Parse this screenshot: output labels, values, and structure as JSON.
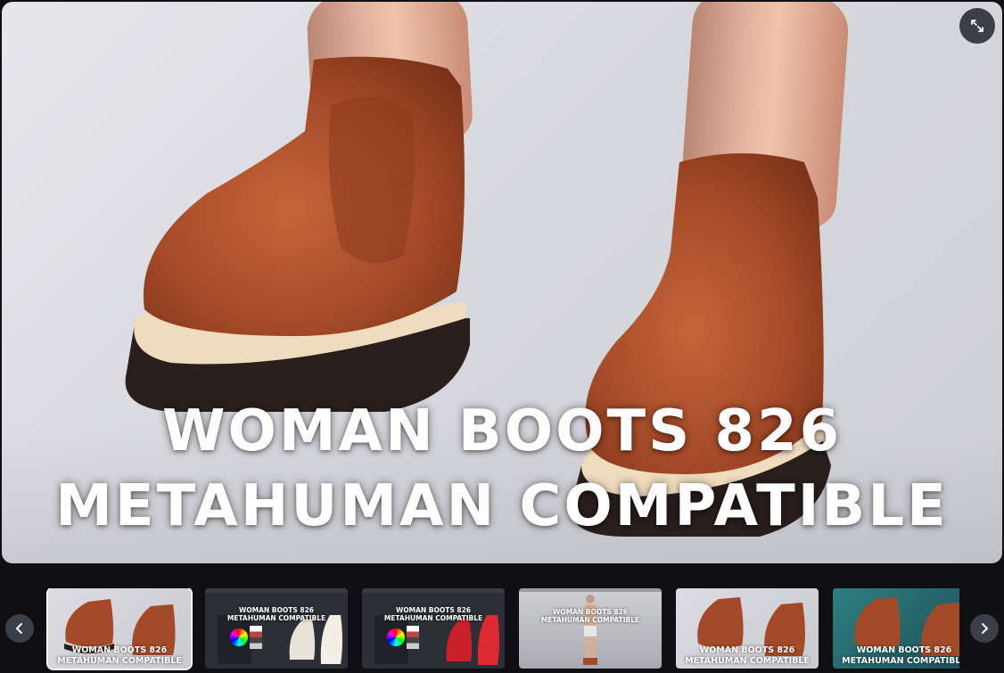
{
  "main": {
    "title_line1": "WOMAN BOOTS 826",
    "title_line2": "METAHUMAN COMPATIBLE",
    "expand_icon": "expand-icon",
    "colors": {
      "boot": "#b2532e",
      "sole": "#2a1f1c",
      "welt": "#efdcbf"
    }
  },
  "gallery": {
    "prev_icon": "chevron-left-icon",
    "next_icon": "chevron-right-icon",
    "thumbnails": [
      {
        "caption_line1": "WOMAN BOOTS 826",
        "caption_line2": "METAHUMAN COMPATIBLE",
        "active": true
      },
      {
        "caption_line1": "WOMAN BOOTS 826",
        "caption_line2": "METAHUMAN COMPATIBLE",
        "active": false
      },
      {
        "caption_line1": "WOMAN BOOTS 826",
        "caption_line2": "METAHUMAN COMPATIBLE",
        "active": false
      },
      {
        "caption_line1": "WOMAN BOOTS 826",
        "caption_line2": "METAHUMAN COMPATIBLE",
        "active": false
      },
      {
        "caption_line1": "WOMAN BOOTS 826",
        "caption_line2": "METAHUMAN COMPATIBLE",
        "active": false
      },
      {
        "caption_line1": "WOMAN BOOTS 826",
        "caption_line2": "METAHUMAN COMPATIBLE",
        "active": false
      }
    ]
  }
}
